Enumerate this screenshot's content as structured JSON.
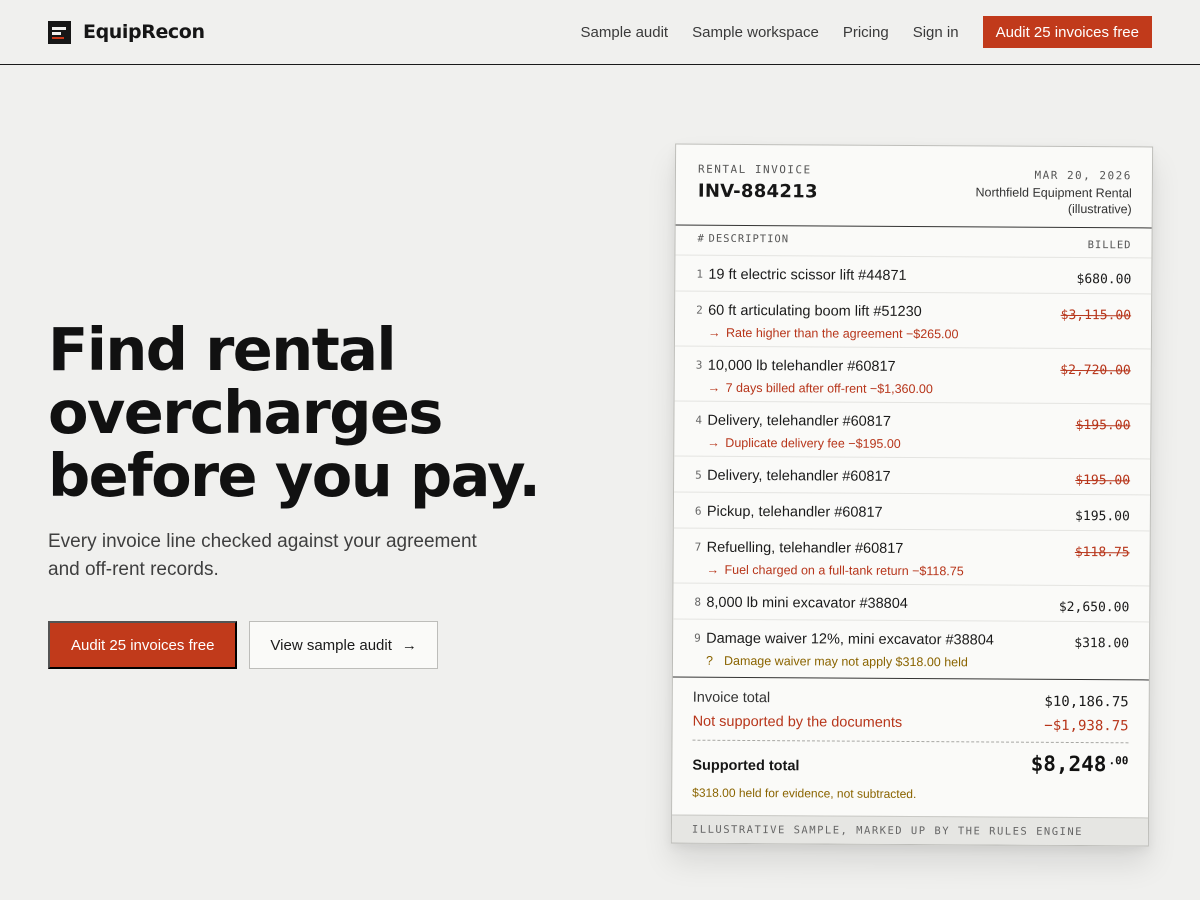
{
  "brand": {
    "name": "EquipRecon",
    "colors": {
      "accent": "#c13a1b",
      "flag": "#b7351a",
      "held": "#8a6400",
      "background": "#f0f0ee"
    }
  },
  "nav": {
    "links": [
      "Sample audit",
      "Sample workspace",
      "Pricing",
      "Sign in"
    ],
    "cta": "Audit 25 invoices free"
  },
  "hero": {
    "title_lines": [
      "Find rental",
      "overcharges",
      "before you pay."
    ],
    "subtitle": "Every invoice line checked against your agreement and off-rent records.",
    "primary_cta": "Audit 25 invoices free",
    "secondary_cta": "View sample audit",
    "secondary_cta_arrow": "→"
  },
  "invoice": {
    "kicker": "RENTAL INVOICE",
    "number": "INV-884213",
    "date": "MAR 20, 2026",
    "vendor": "Northfield Equipment Rental (illustrative)",
    "columns": {
      "num": "#",
      "description": "DESCRIPTION",
      "billed": "BILLED"
    },
    "items": [
      {
        "num": "1",
        "description": "19 ft electric scissor lift #44871",
        "amount": "$680.00",
        "struck": false,
        "note": "",
        "note_mark": "",
        "note_type": ""
      },
      {
        "num": "2",
        "description": "60 ft articulating boom lift #51230",
        "amount": "$3,115.00",
        "struck": true,
        "note": "Rate higher than the agreement −$265.00",
        "note_mark": "→",
        "note_type": "flag"
      },
      {
        "num": "3",
        "description": "10,000 lb telehandler #60817",
        "amount": "$2,720.00",
        "struck": true,
        "note": "7 days billed after off-rent −$1,360.00",
        "note_mark": "→",
        "note_type": "flag"
      },
      {
        "num": "4",
        "description": "Delivery, telehandler #60817",
        "amount": "$195.00",
        "struck": true,
        "note": "Duplicate delivery fee −$195.00",
        "note_mark": "→",
        "note_type": "flag"
      },
      {
        "num": "5",
        "description": "Delivery, telehandler #60817",
        "amount": "$195.00",
        "struck": true,
        "note": "",
        "note_mark": "",
        "note_type": ""
      },
      {
        "num": "6",
        "description": "Pickup, telehandler #60817",
        "amount": "$195.00",
        "struck": false,
        "note": "",
        "note_mark": "",
        "note_type": ""
      },
      {
        "num": "7",
        "description": "Refuelling, telehandler #60817",
        "amount": "$118.75",
        "struck": true,
        "note": "Fuel charged on a full-tank return −$118.75",
        "note_mark": "→",
        "note_type": "flag"
      },
      {
        "num": "8",
        "description": "8,000 lb mini excavator #38804",
        "amount": "$2,650.00",
        "struck": false,
        "note": "",
        "note_mark": "",
        "note_type": ""
      },
      {
        "num": "9",
        "description": "Damage waiver 12%, mini excavator #38804",
        "amount": "$318.00",
        "struck": false,
        "note": "Damage waiver may not apply $318.00 held",
        "note_mark": "?",
        "note_type": "held"
      }
    ],
    "totals": {
      "invoice_total_label": "Invoice total",
      "invoice_total": "$10,186.75",
      "unsupported_label": "Not supported by the documents",
      "unsupported": "−$1,938.75",
      "supported_label": "Supported total",
      "supported_main": "$8,248",
      "supported_cents": ".00",
      "held_note": "$318.00 held for evidence, not subtracted."
    },
    "footer": "ILLUSTRATIVE SAMPLE, MARKED UP BY THE RULES ENGINE"
  }
}
